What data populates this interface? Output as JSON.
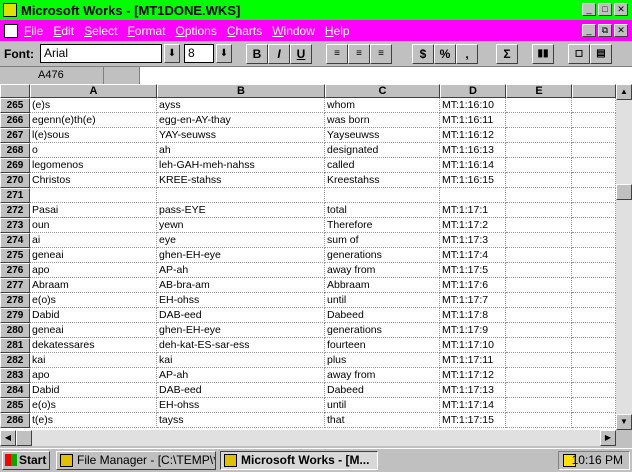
{
  "window": {
    "title": "Microsoft Works - [MT1DONE.WKS]"
  },
  "menu": [
    "File",
    "Edit",
    "Select",
    "Format",
    "Options",
    "Charts",
    "Window",
    "Help"
  ],
  "toolbar": {
    "font_label": "Font:",
    "font_name": "Arial",
    "font_size": "8",
    "bold": "B",
    "italic": "I",
    "underline": "U",
    "currency": "$",
    "percent": "%",
    "comma": ",",
    "sum": "Σ"
  },
  "formula": {
    "cell_ref": "A476",
    "value": ""
  },
  "columns": [
    "A",
    "B",
    "C",
    "D",
    "E"
  ],
  "rows": [
    {
      "n": "265",
      "a": "(e)s",
      "b": "ayss",
      "c": "whom",
      "d": "MT:1:16:10"
    },
    {
      "n": "266",
      "a": "egenn(e)th(e)",
      "b": "egg-en-AY-thay",
      "c": "was born",
      "d": "MT:1:16:11"
    },
    {
      "n": "267",
      "a": "l(e)sous",
      "b": "YAY-seuwss",
      "c": "Yayseuwss",
      "d": "MT:1:16:12"
    },
    {
      "n": "268",
      "a": "o",
      "b": "ah",
      "c": "designated",
      "d": "MT:1:16:13"
    },
    {
      "n": "269",
      "a": "legomenos",
      "b": "leh-GAH-meh-nahss",
      "c": "called",
      "d": "MT:1:16:14"
    },
    {
      "n": "270",
      "a": "Christos",
      "b": "KREE-stahss",
      "c": "Kreestahss",
      "d": "MT:1:16:15"
    },
    {
      "n": "271",
      "a": "",
      "b": "",
      "c": "",
      "d": ""
    },
    {
      "n": "272",
      "a": "Pasai",
      "b": "pass-EYE",
      "c": "total",
      "d": "MT:1:17:1"
    },
    {
      "n": "273",
      "a": "oun",
      "b": "yewn",
      "c": "Therefore",
      "d": "MT:1:17:2"
    },
    {
      "n": "274",
      "a": "ai",
      "b": "eye",
      "c": "sum of",
      "d": "MT:1:17:3"
    },
    {
      "n": "275",
      "a": "geneai",
      "b": "ghen-EH-eye",
      "c": "generations",
      "d": "MT:1:17:4"
    },
    {
      "n": "276",
      "a": "apo",
      "b": "AP-ah",
      "c": "away from",
      "d": "MT:1:17:5"
    },
    {
      "n": "277",
      "a": "Abraam",
      "b": "AB-bra-am",
      "c": "Abbraam",
      "d": "MT:1:17:6"
    },
    {
      "n": "278",
      "a": "e(o)s",
      "b": "EH-ohss",
      "c": "until",
      "d": "MT:1:17:7"
    },
    {
      "n": "279",
      "a": "Dabid",
      "b": "DAB-eed",
      "c": "Dabeed",
      "d": "MT:1:17:8"
    },
    {
      "n": "280",
      "a": "geneai",
      "b": "ghen-EH-eye",
      "c": "generations",
      "d": "MT:1:17:9"
    },
    {
      "n": "281",
      "a": "dekatessares",
      "b": "deh-kat-ES-sar-ess",
      "c": "fourteen",
      "d": "MT:1:17:10"
    },
    {
      "n": "282",
      "a": "kai",
      "b": "kai",
      "c": "plus",
      "d": "MT:1:17:11"
    },
    {
      "n": "283",
      "a": "apo",
      "b": "AP-ah",
      "c": "away from",
      "d": "MT:1:17:12"
    },
    {
      "n": "284",
      "a": "Dabid",
      "b": "DAB-eed",
      "c": "Dabeed",
      "d": "MT:1:17:13"
    },
    {
      "n": "285",
      "a": "e(o)s",
      "b": "EH-ohss",
      "c": "until",
      "d": "MT:1:17:14"
    },
    {
      "n": "286",
      "a": "t(e)s",
      "b": "tayss",
      "c": "that",
      "d": "MT:1:17:15"
    }
  ],
  "taskbar": {
    "start": "Start",
    "tasks": [
      "File Manager - [C:\\TEMP\\*...",
      "Microsoft Works - [M..."
    ],
    "clock": "10:16 PM"
  }
}
